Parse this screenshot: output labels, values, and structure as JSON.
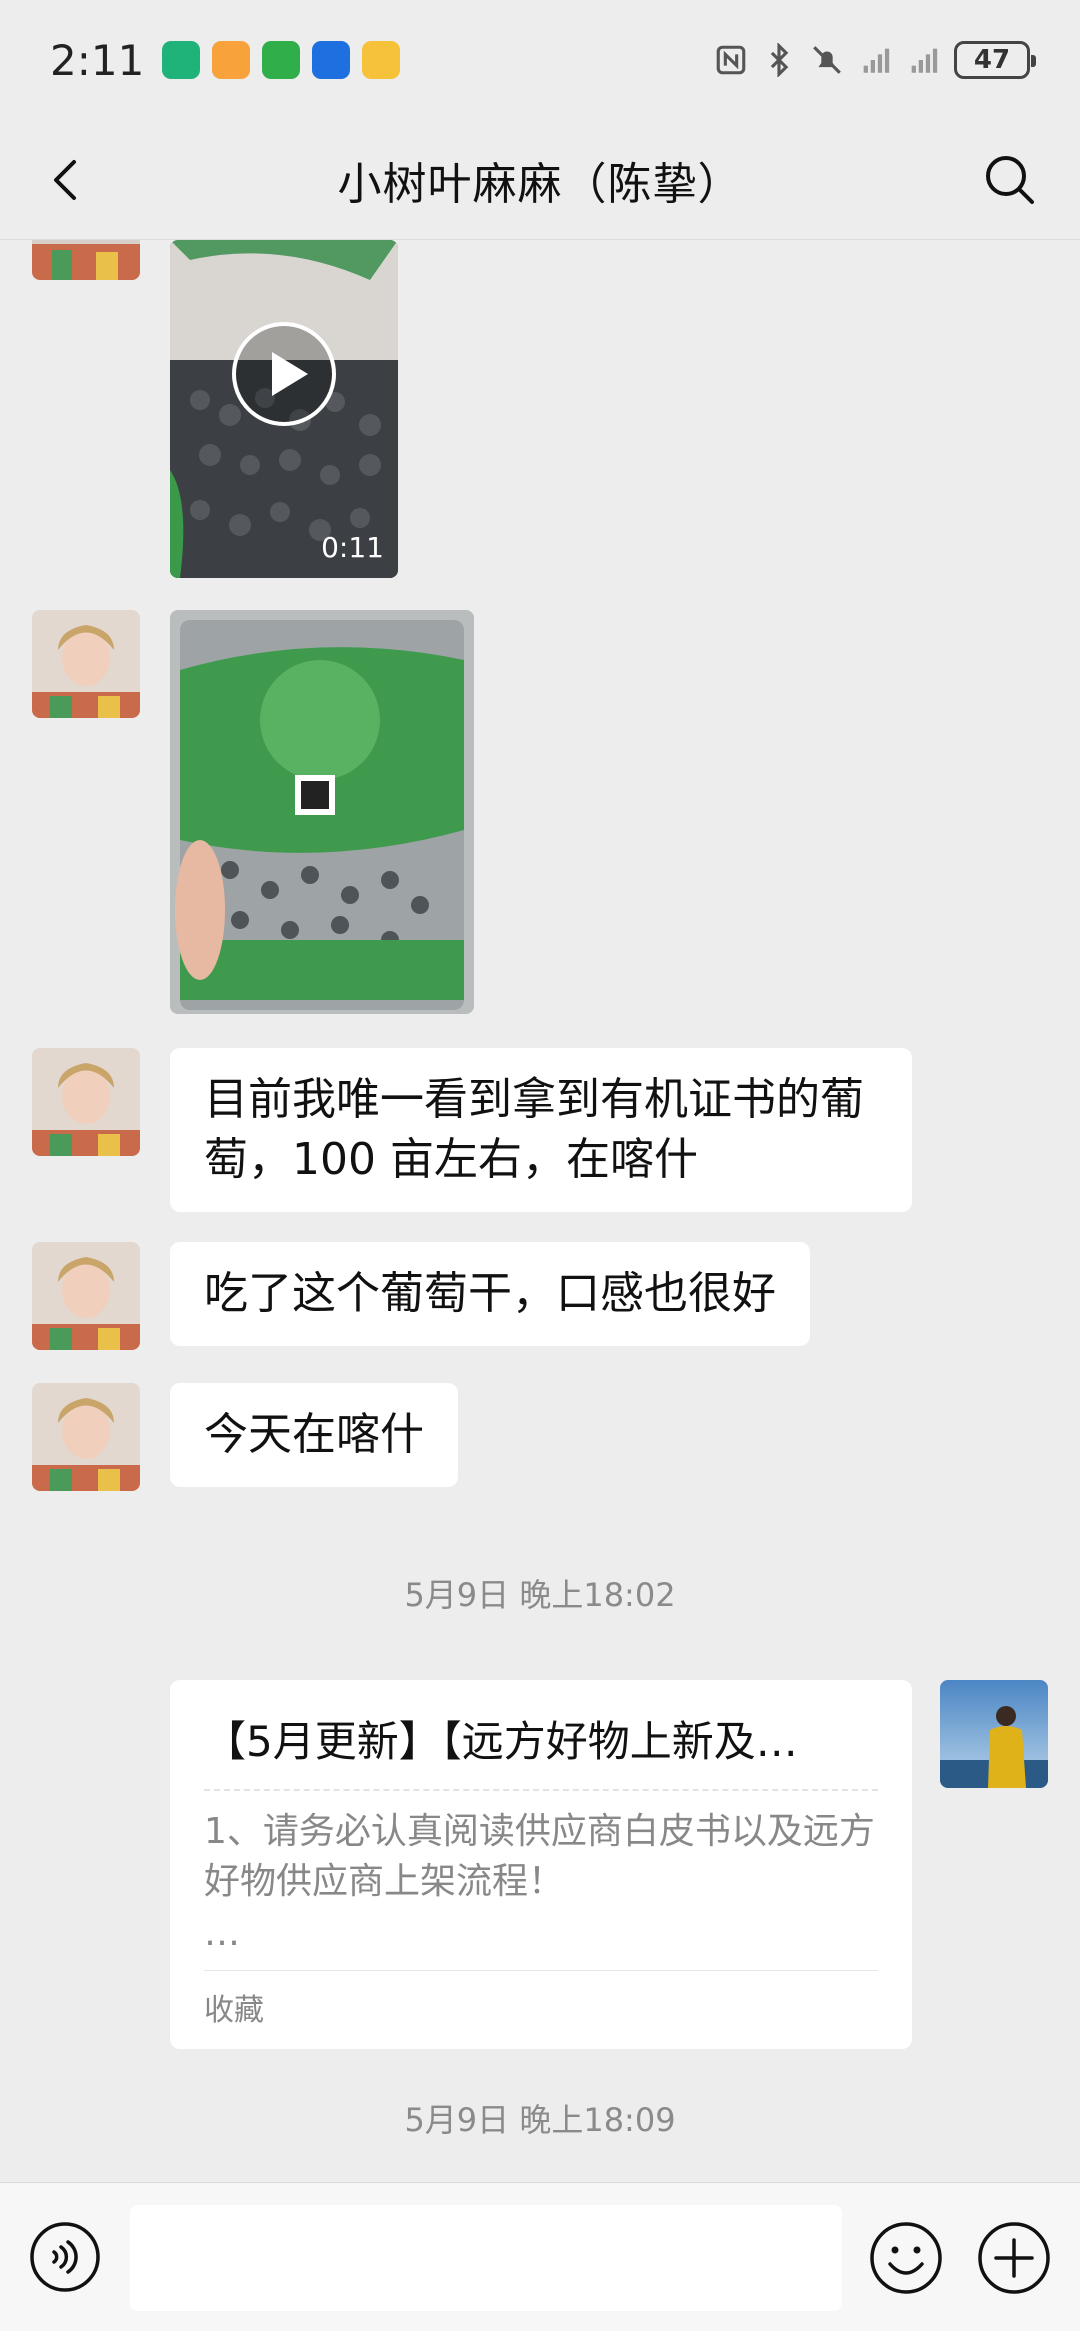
{
  "status_bar": {
    "time": "2:11",
    "battery": "47",
    "app_icons": [
      "app-icon-green",
      "app-icon-orange",
      "app-icon-green-2",
      "app-icon-blue-plane",
      "app-icon-yellow"
    ],
    "system_icons": [
      "nfc-icon",
      "bluetooth-icon",
      "mute-icon",
      "signal-icon",
      "signal-icon-2"
    ]
  },
  "header": {
    "title": "小树叶麻麻（陈挚）",
    "back_icon": "chevron-left-icon",
    "search_icon": "search-icon"
  },
  "messages": [
    {
      "type": "video",
      "sender": "other",
      "duration": "0:11"
    },
    {
      "type": "image",
      "sender": "other"
    },
    {
      "type": "text",
      "sender": "other",
      "text": "目前我唯一看到拿到有机证书的葡萄，100 亩左右，在喀什"
    },
    {
      "type": "text",
      "sender": "other",
      "text": "吃了这个葡萄干，口感也很好"
    },
    {
      "type": "text",
      "sender": "other",
      "text": "今天在喀什"
    }
  ],
  "timestamps": [
    "5月9日 晚上18:02",
    "5月9日 晚上18:09"
  ],
  "card": {
    "sender": "me",
    "title": "【5月更新】【远方好物上新及…",
    "desc": "1、请务必认真阅读供应商白皮书以及远方好物供应商上架流程！",
    "more": "…",
    "footer": "收藏"
  },
  "input_bar": {
    "voice_icon": "voice-icon",
    "emoji_icon": "emoji-icon",
    "plus_icon": "plus-icon",
    "input_value": ""
  },
  "colors": {
    "background": "#ededed",
    "bubble": "#ffffff",
    "timestamp": "#8a8a8a"
  }
}
